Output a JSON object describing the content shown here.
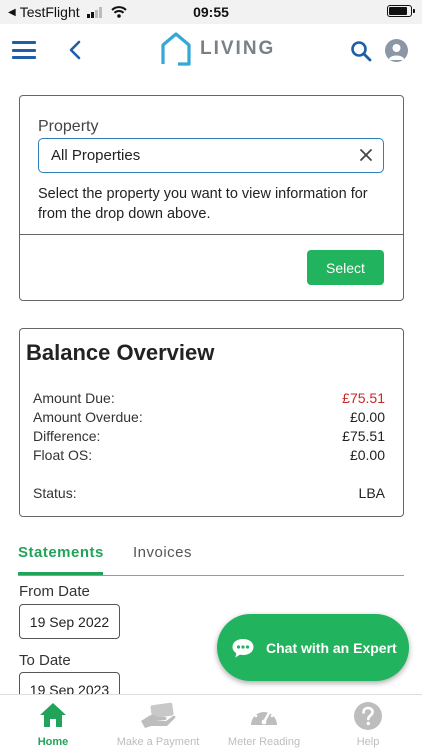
{
  "status_bar": {
    "carrier": "TestFlight",
    "time": "09:55"
  },
  "header": {
    "logo_text": "LIVING"
  },
  "property": {
    "label": "Property",
    "selected": "All Properties",
    "help_text": "Select the property you want to view information for from the drop down above.",
    "select_label": "Select"
  },
  "balance": {
    "title": "Balance Overview",
    "amount_due": {
      "label": "Amount Due:",
      "value": "£75.51"
    },
    "amount_overdue": {
      "label": "Amount Overdue:",
      "value": "£0.00"
    },
    "difference": {
      "label": "Difference:",
      "value": "£75.51"
    },
    "float_os": {
      "label": "Float OS:",
      "value": "£0.00"
    },
    "status": {
      "label": "Status:",
      "value": "LBA"
    }
  },
  "tabs": {
    "statements": "Statements",
    "invoices": "Invoices",
    "active": "statements"
  },
  "dates": {
    "from_label": "From Date",
    "from_value": "19 Sep 2022",
    "to_label": "To Date",
    "to_value": "19 Sep 2023"
  },
  "chat": {
    "label": "Chat with an Expert"
  },
  "nav": {
    "home": "Home",
    "payment": "Make a Payment",
    "meter": "Meter Reading",
    "help": "Help",
    "active": "home"
  },
  "colors": {
    "brand_blue": "#1e5fa8",
    "accent_green": "#22b35e",
    "logo_cyan": "#35a7d6",
    "due_red": "#c62828"
  },
  "icons": [
    "hamburger-icon",
    "back-chevron-icon",
    "house-logo-icon",
    "search-icon",
    "user-avatar-icon",
    "clear-icon",
    "chat-bubble-icon",
    "home-icon",
    "payment-hand-icon",
    "gauge-icon",
    "help-icon"
  ]
}
